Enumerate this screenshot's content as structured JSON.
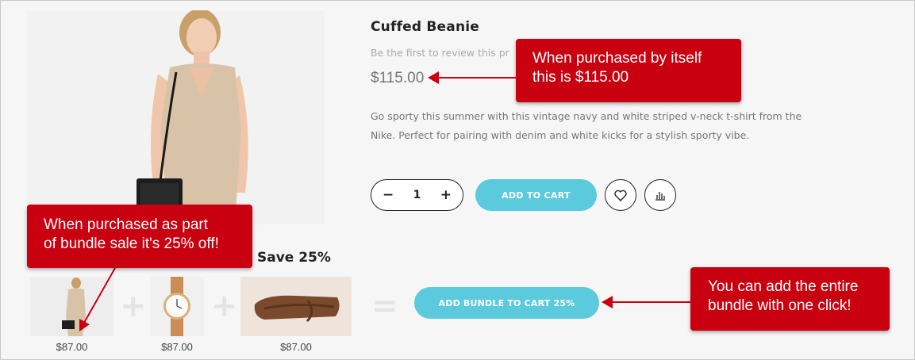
{
  "product": {
    "title": "Cuffed Beanie",
    "review_text": "Be the first to review this pr",
    "price": "$115.00",
    "description": "Go sporty this summer with this vintage navy and white striped v-neck t-shirt from the Nike. Perfect for pairing with denim and white kicks for a stylish sporty vibe."
  },
  "actions": {
    "qty_minus": "−",
    "qty_value": "1",
    "qty_plus": "+",
    "add_to_cart": "ADD TO CART",
    "wishlist_icon": "heart-icon",
    "compare_icon": "bar-chart-icon"
  },
  "bundle": {
    "heading": "Save 25%",
    "items": [
      {
        "price": "$87.00",
        "image": "woman-in-dress"
      },
      {
        "price": "$87.00",
        "image": "leather-watch"
      },
      {
        "price": "$87.00",
        "image": "leather-pouch"
      }
    ],
    "plus": "+",
    "equals": "=",
    "add_bundle": "ADD BUNDLE TO CART 25%"
  },
  "callouts": {
    "single_price_line1": "When purchased by itself",
    "single_price_line2": "this is $115.00",
    "bundle_discount_line1": "When purchased as part",
    "bundle_discount_line2": "of bundle sale it's 25% off!",
    "bundle_button_line1": "You can add the entire",
    "bundle_button_line2": "bundle with one click!"
  },
  "colors": {
    "accent": "#5ccadd",
    "callout": "#c8000f",
    "background": "#f6f6f6"
  }
}
